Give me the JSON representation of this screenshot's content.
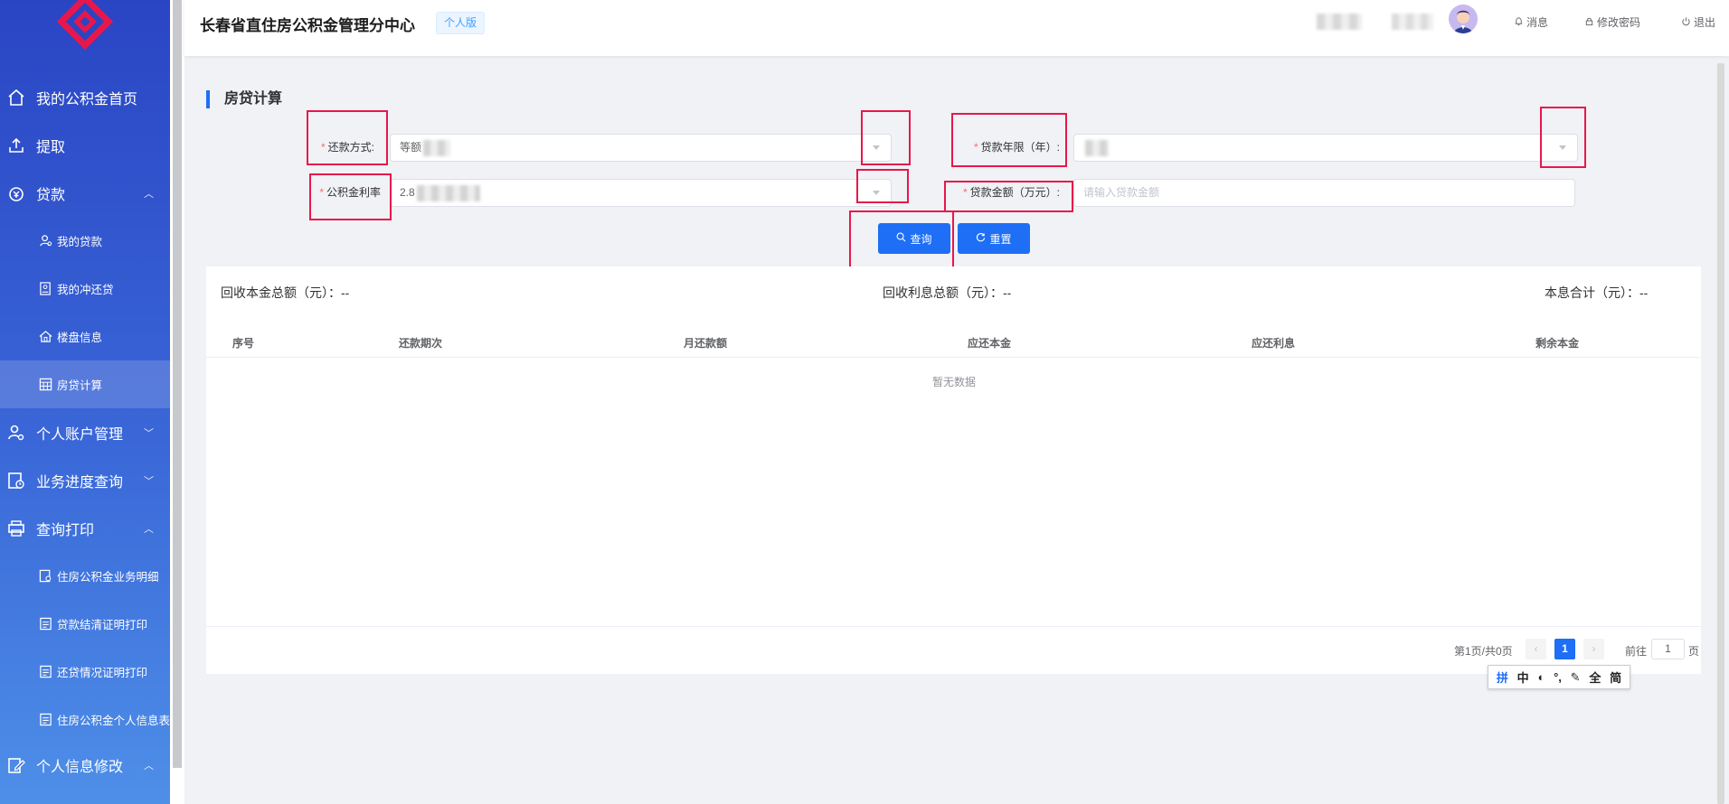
{
  "header": {
    "title": "长春省直住房公积金管理分中心",
    "tag": "个人版",
    "links": {
      "messages": "消息",
      "change_password": "修改密码",
      "logout": "退出"
    }
  },
  "sidebar": {
    "items": [
      {
        "label": "我的公积金首页",
        "icon": "home-icon"
      },
      {
        "label": "提取",
        "icon": "upload-icon"
      },
      {
        "label": "贷款",
        "icon": "money-icon",
        "arrow": "︿"
      },
      {
        "label": "个人账户管理",
        "icon": "user-settings-icon",
        "arrow": "﹀"
      },
      {
        "label": "业务进度查询",
        "icon": "progress-icon",
        "arrow": "﹀"
      },
      {
        "label": "查询打印",
        "icon": "printer-icon",
        "arrow": "︿"
      },
      {
        "label": "个人信息修改",
        "icon": "edit-icon",
        "arrow": "︿"
      }
    ],
    "loan_sub": [
      {
        "label": "我的贷款"
      },
      {
        "label": "我的冲还贷"
      },
      {
        "label": "楼盘信息"
      },
      {
        "label": "房贷计算"
      }
    ],
    "print_sub": [
      {
        "label": "住房公积金业务明细"
      },
      {
        "label": "贷款结清证明打印"
      },
      {
        "label": "还贷情况证明打印"
      },
      {
        "label": "住房公积金个人信息表"
      }
    ]
  },
  "section_title": "房贷计算",
  "form": {
    "required_mark": "*",
    "repayment_label": "还款方式:",
    "repayment_value": "等额",
    "term_label": "贷款年限（年）:",
    "rate_label": "公积金利率",
    "rate_value": "2.8",
    "amount_label": "贷款金额（万元）:",
    "amount_placeholder": "请输入贷款金额",
    "query_button": "查询",
    "reset_button": "重置"
  },
  "summary": {
    "principal_label": "回收本金总额（元）：",
    "principal_value": "--",
    "interest_label": "回收利息总额（元）：",
    "interest_value": "--",
    "total_label": "本息合计（元）：",
    "total_value": "--"
  },
  "table": {
    "columns": [
      "序号",
      "还款期次",
      "月还款额",
      "应还本金",
      "应还利息",
      "剩余本金"
    ],
    "empty_text": "暂无数据"
  },
  "pagination": {
    "info": "第1页/共0页",
    "current_page": "1",
    "prev": "‹",
    "next": "›",
    "goto_label": "前往",
    "goto_value": "1",
    "page_suffix": "页"
  },
  "ime_toolbar": [
    "拼",
    "中",
    "◐",
    "°,",
    "✎",
    "全",
    "简"
  ],
  "colors": {
    "primary": "#1e6ff5",
    "sidebar_top": "#2a45c4",
    "sidebar_bottom": "#4e8fe8",
    "required": "#f56c6c",
    "highlight_box": "#e8174b"
  }
}
